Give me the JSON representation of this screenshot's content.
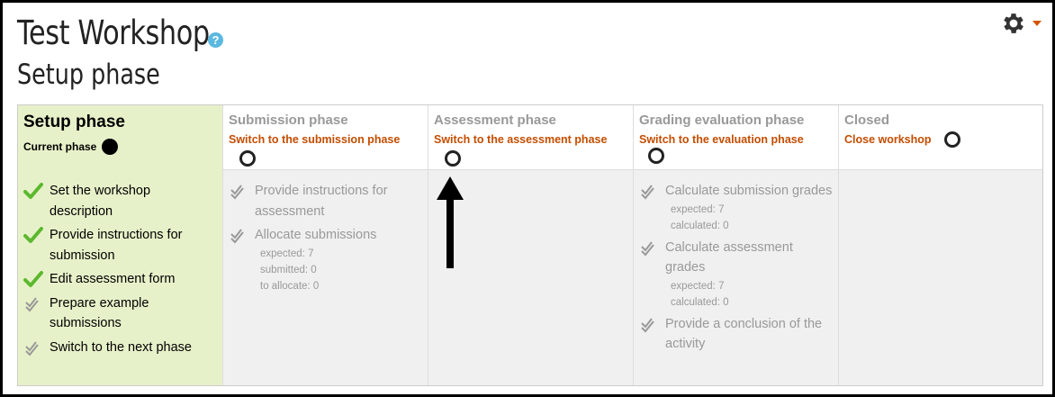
{
  "header": {
    "title": "Test Workshop",
    "subtitle": "Setup phase",
    "help_icon": "question-mark-icon",
    "settings_icon": "gear-icon",
    "settings_menu_icon": "caret-down-icon"
  },
  "colors": {
    "active_phase_bg": "#e7f1c9",
    "link": "#c44d00",
    "done_check": "#5cb82e",
    "todo_check": "#999999",
    "muted_text": "#999999"
  },
  "phases": [
    {
      "title": "Setup phase",
      "current_label": "Current phase",
      "tasks": [
        {
          "label": "Set the workshop description",
          "status": "done",
          "details": []
        },
        {
          "label": "Provide instructions for submission",
          "status": "done",
          "details": []
        },
        {
          "label": "Edit assessment form",
          "status": "done",
          "details": []
        },
        {
          "label": "Prepare example submissions",
          "status": "todo",
          "details": []
        },
        {
          "label": "Switch to the next phase",
          "status": "todo",
          "details": []
        }
      ]
    },
    {
      "title": "Submission phase",
      "switch_label": "Switch to the submission phase",
      "tasks": [
        {
          "label": "Provide instructions for assessment",
          "status": "todo",
          "details": []
        },
        {
          "label": "Allocate submissions",
          "status": "todo",
          "details": [
            "expected: 7",
            "submitted: 0",
            "to allocate: 0"
          ]
        }
      ]
    },
    {
      "title": "Assessment phase",
      "switch_label": "Switch to the assessment phase",
      "tasks": []
    },
    {
      "title": "Grading evaluation phase",
      "switch_label": "Switch to the evaluation phase",
      "tasks": [
        {
          "label": "Calculate submission grades",
          "status": "todo",
          "details": [
            "expected: 7",
            "calculated: 0"
          ]
        },
        {
          "label": "Calculate assessment grades",
          "status": "todo",
          "details": [
            "expected: 7",
            "calculated: 0"
          ]
        },
        {
          "label": "Provide a conclusion of the activity",
          "status": "todo",
          "details": []
        }
      ]
    },
    {
      "title": "Closed",
      "switch_label": "Close workshop",
      "tasks": []
    }
  ],
  "annotation": {
    "arrow_target": "Switch to the assessment phase"
  }
}
